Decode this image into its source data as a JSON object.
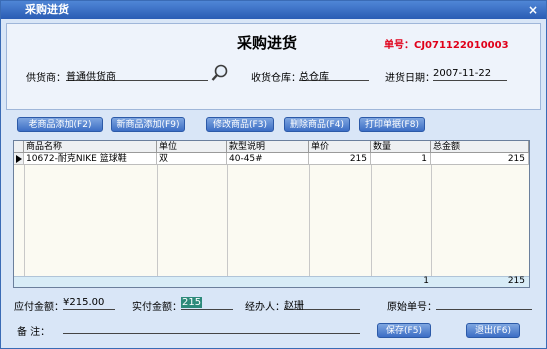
{
  "window": {
    "title": "采购进货",
    "close_glyph": "×"
  },
  "header": {
    "form_title": "采购进货",
    "order_no": "单号：CJ071122010003",
    "supplier_label": "供货商：",
    "supplier_value": "普通供货商",
    "warehouse_label": "收货仓库：",
    "warehouse_value": "总仓库",
    "date_label": "进货日期：",
    "date_value": "2007-11-22"
  },
  "toolbar": {
    "old_add": "老商品添加(F2)",
    "new_add": "新商品添加(F9)",
    "edit": "修改商品(F3)",
    "delete": "删除商品(F4)",
    "print": "打印单据(F8)"
  },
  "grid": {
    "columns": [
      "商品名称",
      "单位",
      "款型说明",
      "单价",
      "数量",
      "总金额"
    ],
    "rows": [
      {
        "name": "10672-耐克NIKE 篮球鞋",
        "unit": "双",
        "style": "40-45#",
        "price": "215",
        "qty": "1",
        "total": "215"
      }
    ],
    "footer": {
      "qty": "1",
      "total": "215"
    }
  },
  "bottom": {
    "payable_label": "应付金额：",
    "payable_value": "¥215.00",
    "paid_label": "实付金额：",
    "paid_value": "215",
    "handler_label": "经办人：",
    "handler_value": "赵珊",
    "orig_label": "原始单号：",
    "orig_value": "",
    "remark_label": "备    注：",
    "remark_value": "",
    "save_button": "保存(F5)",
    "exit_button": "退出(F6)"
  }
}
